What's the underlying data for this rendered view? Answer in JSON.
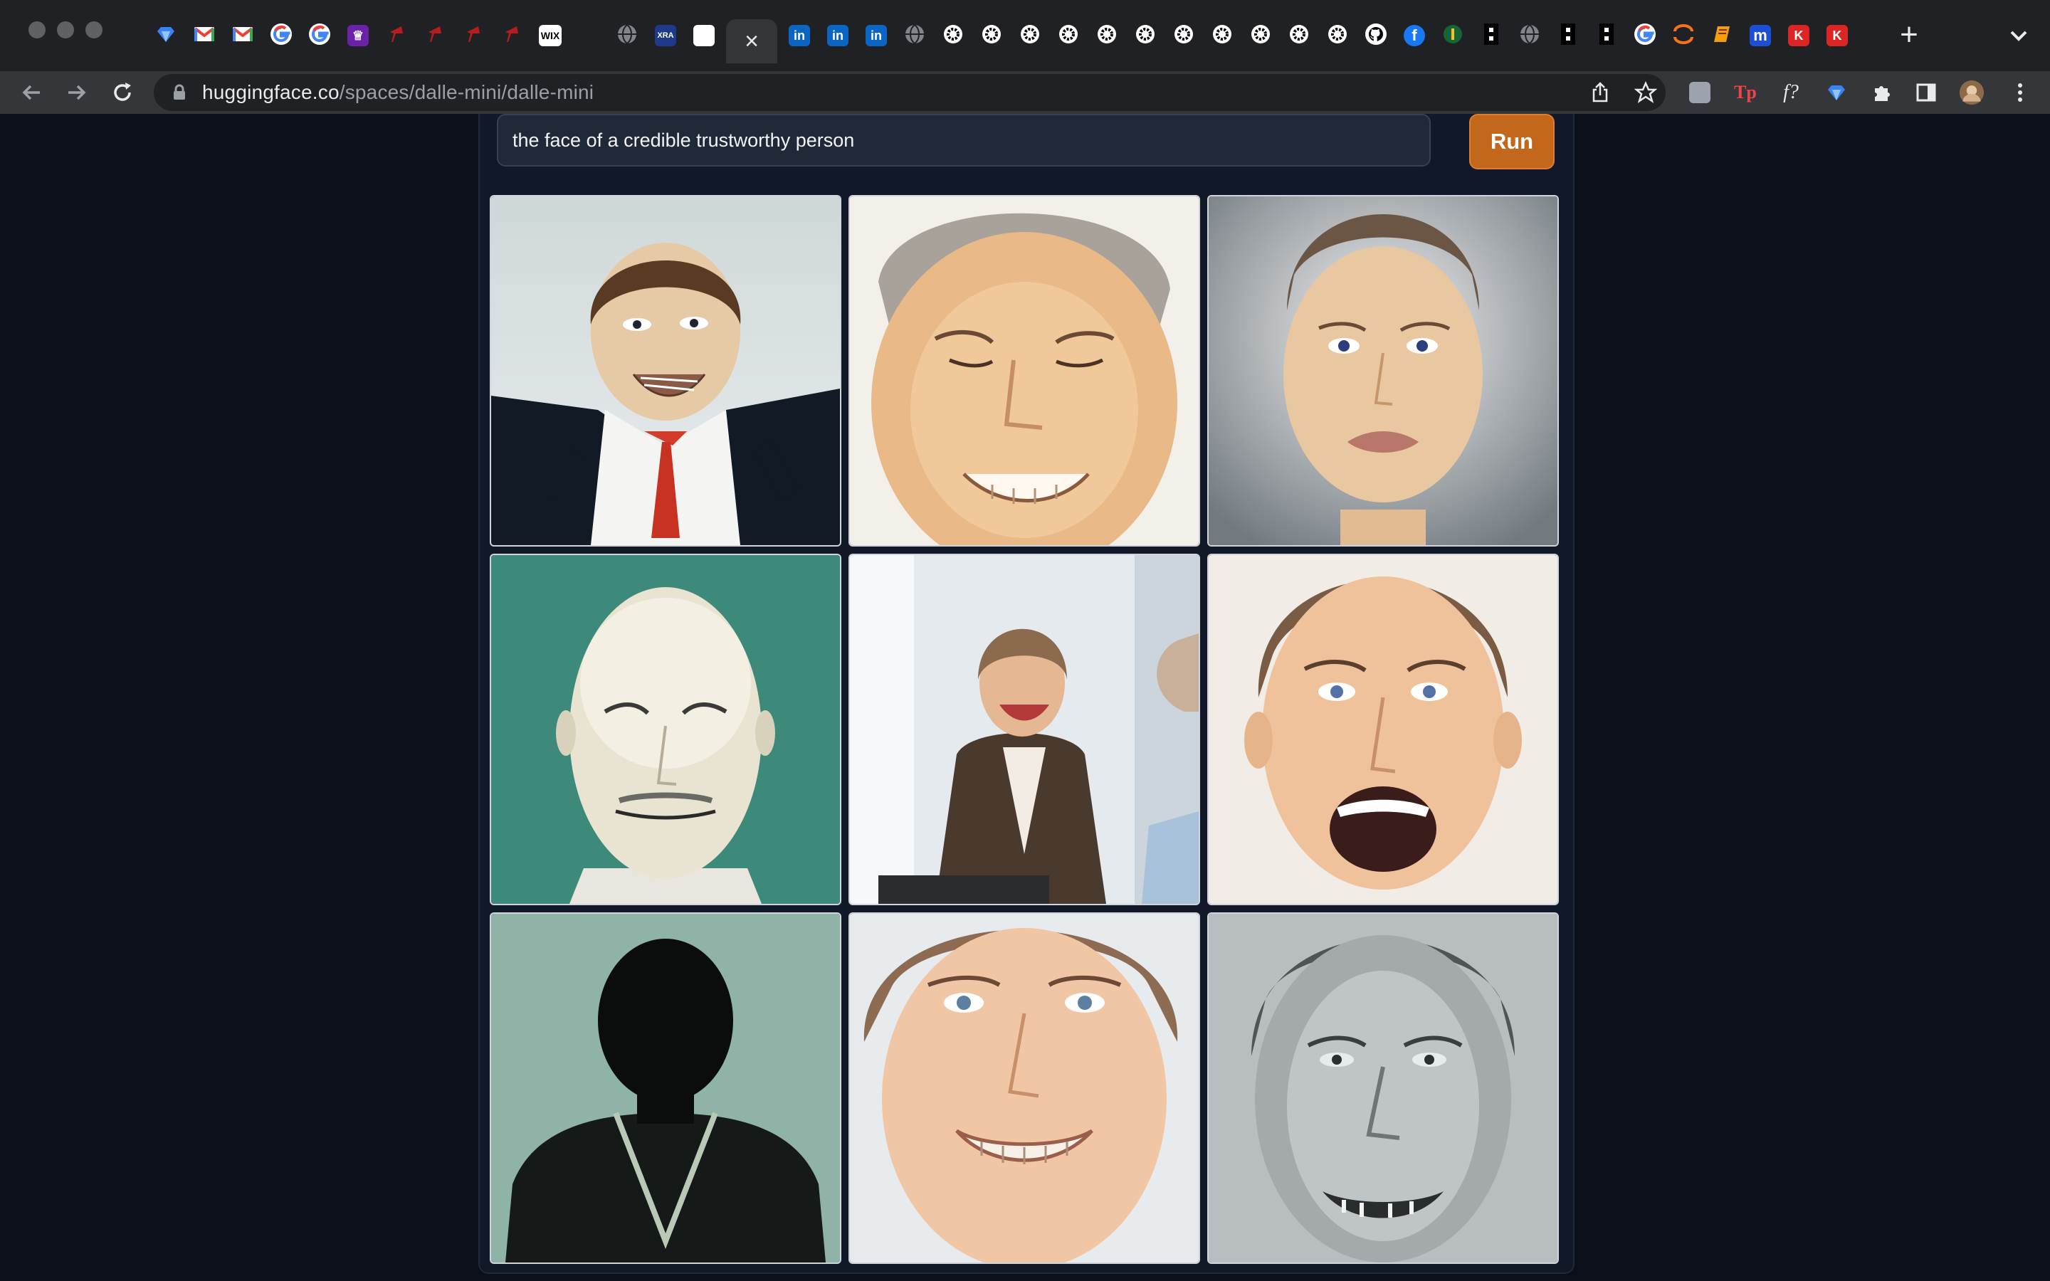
{
  "browser": {
    "tab_strip": {
      "favicons": [
        "diamond-icon",
        "gmail-icon",
        "gmail-icon",
        "google-icon",
        "google-icon",
        "purple-app-icon",
        "red-app-icon",
        "red-app-icon",
        "red-app-icon",
        "red-app-icon",
        "wix-icon",
        "blank-icon",
        "globe-icon",
        "xra-icon",
        "white-square-icon"
      ],
      "favicons_after": [
        "linkedin-icon",
        "linkedin-icon",
        "linkedin-icon",
        "globe-icon",
        "gear-icon",
        "gear-icon",
        "gear-icon",
        "gear-icon",
        "gear-icon",
        "gear-icon",
        "gear-icon",
        "gear-icon",
        "gear-icon",
        "gear-icon",
        "gear-icon",
        "github-icon",
        "facebook-icon",
        "app-icon",
        "dots-icon",
        "globe-icon",
        "dots-icon",
        "dots-icon",
        "google-icon",
        "arc-icon",
        "book-icon",
        "m-icon",
        "k-icon",
        "k-icon"
      ],
      "wix_label": "WIX",
      "xra_label": "XRA",
      "linkedin_label": "in",
      "k_label": "K",
      "m_label": "m",
      "tp_label": "Tp",
      "f_label": "f?",
      "new_tab_label": "+"
    },
    "address_bar": {
      "url_host": "huggingface.co",
      "url_path": "/spaces/dalle-mini/dalle-mini"
    }
  },
  "app": {
    "prompt": {
      "value": "the face of a credible trustworthy person"
    },
    "run_button": {
      "label": "Run"
    },
    "gallery": {
      "images": [
        "generated-image-1",
        "generated-image-2",
        "generated-image-3",
        "generated-image-4",
        "generated-image-5",
        "generated-image-6",
        "generated-image-7",
        "generated-image-8",
        "generated-image-9"
      ]
    }
  },
  "colors": {
    "page_bg": "#0b0f19",
    "panel_bg": "#111827",
    "run_button": "#c2671c"
  }
}
